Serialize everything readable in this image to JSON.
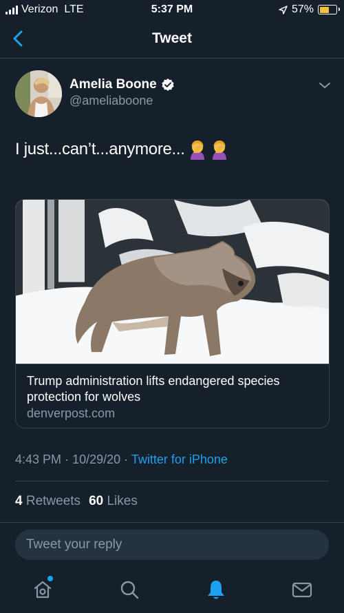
{
  "status_bar": {
    "carrier": "Verizon",
    "network": "LTE",
    "time": "5:37 PM",
    "battery": "57%",
    "battery_level": 0.57,
    "battery_color": "#f6c23a"
  },
  "nav": {
    "title": "Tweet"
  },
  "author": {
    "name": "Amelia Boone",
    "handle": "@ameliaboone",
    "verified": true
  },
  "tweet": {
    "text": "I just...can’t...anymore...",
    "emoji": [
      "facepalm-emoji",
      "facepalm-emoji"
    ]
  },
  "card": {
    "title": "Trump administration lifts endangered species protection for wolves",
    "domain": "denverpost.com"
  },
  "meta": {
    "time": "4:43 PM",
    "separator": "·",
    "date": "10/29/20",
    "source": "Twitter for iPhone"
  },
  "stats": {
    "retweets_count": "4",
    "retweets_label": "Retweets",
    "likes_count": "60",
    "likes_label": "Likes"
  },
  "reply": {
    "placeholder": "Tweet your reply"
  },
  "tabbar": {
    "items": [
      "home-icon",
      "search-icon",
      "notifications-icon",
      "messages-icon"
    ],
    "active": "notifications-icon"
  },
  "colors": {
    "background": "#15202b",
    "accent": "#1da1f2",
    "muted": "#8899a6",
    "border": "#38444d"
  }
}
